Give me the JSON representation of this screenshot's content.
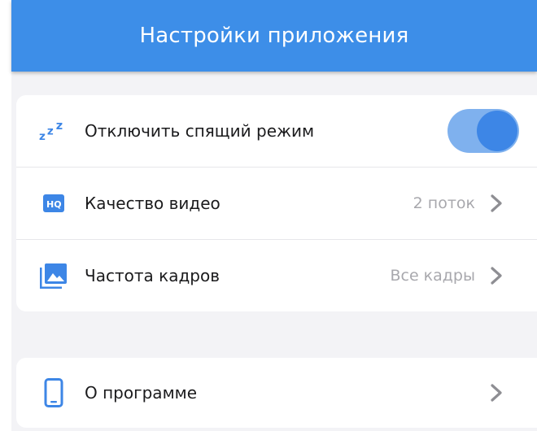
{
  "header": {
    "title": "Настройки приложения"
  },
  "settings": {
    "sleep": {
      "label": "Отключить спящий режим",
      "enabled": true,
      "icon": "zzz-icon"
    },
    "video_quality": {
      "label": "Качество видео",
      "value": "2 поток",
      "icon": "hq-icon"
    },
    "frame_rate": {
      "label": "Частота кадров",
      "value": "Все кадры",
      "icon": "image-icon"
    },
    "about": {
      "label": "О программе",
      "icon": "phone-icon"
    }
  },
  "colors": {
    "accent": "#3d8ee8",
    "toggle_track": "#7fb1ee",
    "toggle_knob": "#3d86e6",
    "secondary_text": "#a8a8ad"
  }
}
